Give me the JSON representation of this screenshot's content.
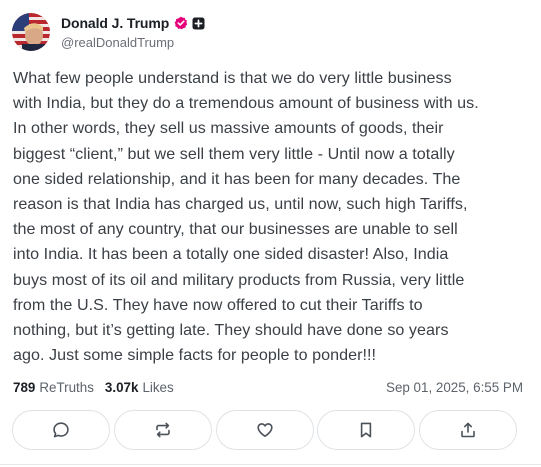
{
  "author": {
    "display_name": "Donald J. Trump",
    "handle": "@realDonaldTrump"
  },
  "post": {
    "lines": [
      "What few people understand is that we do very little business",
      "with India, but they do a tremendous amount of business with us.",
      "In other words, they sell us massive amounts of goods, their",
      "biggest “client,” but we sell them very little - Until now a totally",
      "one sided relationship, and it has been for many decades. The",
      "reason is that India has charged us, until now, such high Tariffs,",
      "the most of any country, that our businesses are unable to sell",
      "into India. It has been a totally one sided disaster! Also, India",
      "buys most of its oil and military products from Russia, very little",
      "from the U.S. They have now offered to cut their Tariffs to",
      "nothing, but it’s getting late. They should have done so years",
      "ago. Just some simple facts for people to ponder!!!"
    ]
  },
  "stats": {
    "retruths_count": "789",
    "retruths_label": "ReTruths",
    "likes_count": "3.07k",
    "likes_label": "Likes",
    "timestamp": "Sep 01, 2025, 6:55 PM"
  },
  "actions": [
    {
      "icon": "reply-icon"
    },
    {
      "icon": "retruth-icon"
    },
    {
      "icon": "like-icon"
    },
    {
      "icon": "bookmark-icon"
    },
    {
      "icon": "share-icon"
    }
  ],
  "colors": {
    "verified_badge": "#e5007a",
    "icon_stroke": "#4b5158",
    "border": "#dfe2e6"
  }
}
